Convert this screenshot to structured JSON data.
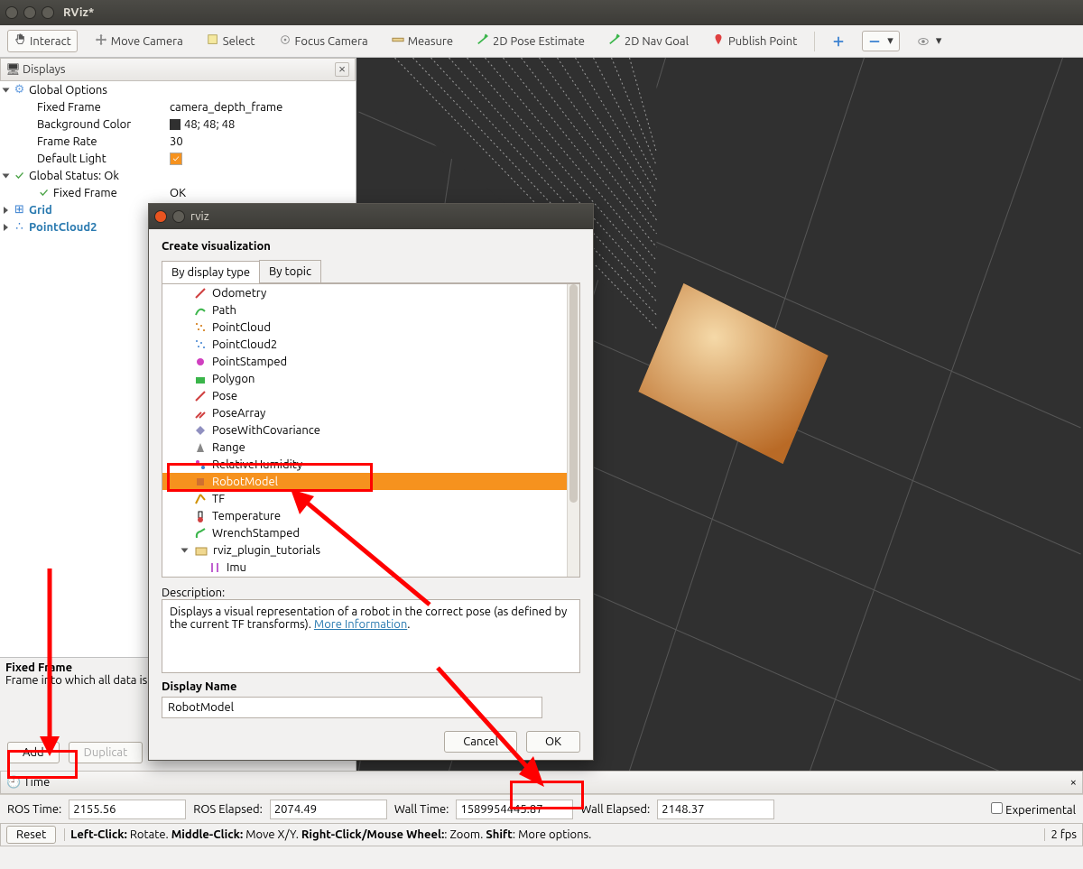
{
  "window": {
    "title": "RViz*"
  },
  "toolbar": {
    "interact": "Interact",
    "move_camera": "Move Camera",
    "select": "Select",
    "focus_camera": "Focus Camera",
    "measure": "Measure",
    "pose_estimate": "2D Pose Estimate",
    "nav_goal": "2D Nav Goal",
    "publish_point": "Publish Point"
  },
  "displays": {
    "panel_title": "Displays",
    "global_options": "Global Options",
    "fixed_frame_k": "Fixed Frame",
    "fixed_frame_v": "camera_depth_frame",
    "bg_color_k": "Background Color",
    "bg_color_v": "48; 48; 48",
    "frame_rate_k": "Frame Rate",
    "frame_rate_v": "30",
    "default_light_k": "Default Light",
    "global_status": "Global Status: Ok",
    "fixed_frame_status_k": "Fixed Frame",
    "fixed_frame_status_v": "OK",
    "grid": "Grid",
    "pointcloud2": "PointCloud2"
  },
  "help": {
    "title": "Fixed Frame",
    "text": "Frame into which all data is transformed before being displayed."
  },
  "buttons": {
    "add": "Add",
    "duplicate": "Duplicat"
  },
  "time_panel": {
    "title": "Time",
    "ros_time_l": "ROS Time:",
    "ros_time_v": "2155.56",
    "ros_elapsed_l": "ROS Elapsed:",
    "ros_elapsed_v": "2074.49",
    "wall_time_l": "Wall Time:",
    "wall_time_v": "1589954445.87",
    "wall_elapsed_l": "Wall Elapsed:",
    "wall_elapsed_v": "2148.37",
    "experimental": "Experimental"
  },
  "status": {
    "reset": "Reset",
    "hint_lc_b": "Left-Click:",
    "hint_lc": " Rotate. ",
    "hint_mc_b": "Middle-Click:",
    "hint_mc": " Move X/Y. ",
    "hint_rc_b": "Right-Click/Mouse Wheel:",
    "hint_rc": ": Zoom. ",
    "hint_sh_b": "Shift",
    "hint_sh": ": More options.",
    "fps": "2 fps"
  },
  "dialog": {
    "title": "rviz",
    "heading": "Create visualization",
    "tab1": "By display type",
    "tab2": "By topic",
    "items": [
      "Odometry",
      "Path",
      "PointCloud",
      "PointCloud2",
      "PointStamped",
      "Polygon",
      "Pose",
      "PoseArray",
      "PoseWithCovariance",
      "Range",
      "RelativeHumidity",
      "RobotModel",
      "TF",
      "Temperature",
      "WrenchStamped",
      "rviz_plugin_tutorials",
      "Imu"
    ],
    "desc_label": "Description:",
    "desc_text": "Displays a visual representation of a robot in the correct pose (as defined by the current TF transforms). ",
    "desc_link": "More Information",
    "display_name_label": "Display Name",
    "display_name_value": "RobotModel",
    "cancel": "Cancel",
    "ok": "OK"
  }
}
